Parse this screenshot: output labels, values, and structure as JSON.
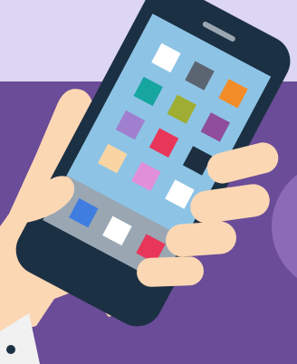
{
  "illustration": {
    "subject": "hand-holding-smartphone",
    "colors": {
      "background_top": "#dcd6f2",
      "background_wall": "#6a4c98",
      "wall_circle": "#8d6ab8",
      "skin": "#fcd7b4",
      "skin_shadow": "#e9b992",
      "sleeve": "#f1f1f1",
      "phone_body": "#1c3043",
      "screen": "#8dc4e6",
      "dock": "#9aa7b3",
      "speaker": "#9aa6b1"
    }
  },
  "phone": {
    "app_icons": [
      {
        "name": "app-icon-white",
        "color": "#ffffff"
      },
      {
        "name": "app-icon-gray",
        "color": "#5b6571"
      },
      {
        "name": "app-icon-orange",
        "color": "#f28c28"
      },
      {
        "name": "app-icon-teal",
        "color": "#17a5a0"
      },
      {
        "name": "app-icon-olive",
        "color": "#9fae33"
      },
      {
        "name": "app-icon-purple",
        "color": "#8f4d9c"
      },
      {
        "name": "app-icon-lavender",
        "color": "#a07fcf"
      },
      {
        "name": "app-icon-crimson",
        "color": "#e8365a"
      },
      {
        "name": "app-icon-navy",
        "color": "#1c2e40"
      },
      {
        "name": "app-icon-peach",
        "color": "#f9d5a3"
      },
      {
        "name": "app-icon-pink",
        "color": "#e18fd8"
      },
      {
        "name": "app-icon-white-2",
        "color": "#ffffff"
      }
    ],
    "dock_icons": [
      {
        "name": "dock-icon-blue",
        "color": "#3f7de0"
      },
      {
        "name": "dock-icon-white",
        "color": "#ffffff"
      },
      {
        "name": "dock-icon-red",
        "color": "#e8365a"
      }
    ]
  }
}
